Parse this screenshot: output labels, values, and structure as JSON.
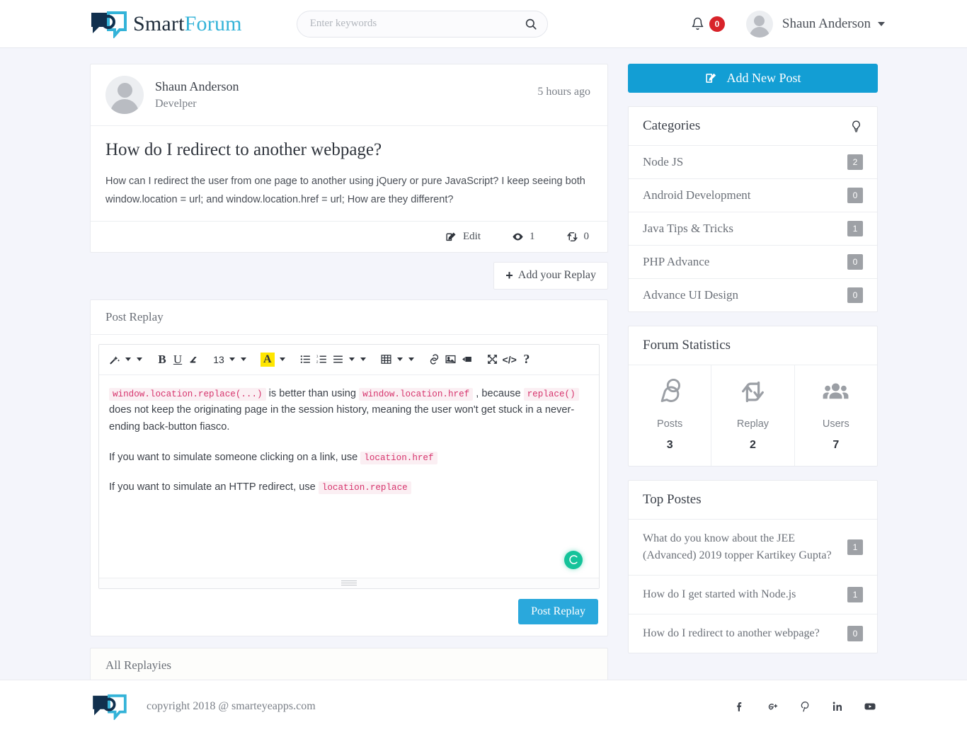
{
  "brand": {
    "name_1": "Smart",
    "name_2": "Forum",
    "logo_icon": "chat-bubbles-logo"
  },
  "search": {
    "placeholder": "Enter keywords",
    "value": "",
    "icon": "search-icon"
  },
  "header": {
    "notification_icon": "bell-icon",
    "notification_count": "0",
    "user_name": "Shaun Anderson",
    "avatar_icon": "user-avatar",
    "caret_icon": "chevron-down-icon"
  },
  "post": {
    "author": "Shaun Anderson",
    "role": "Develper",
    "time": "5 hours ago",
    "title": "How do I redirect to another webpage?",
    "body": "How can I redirect the user from one page to another using jQuery or pure JavaScript? I keep seeing both window.location = url; and window.location.href = url; How are they different?",
    "edit_label": "Edit",
    "edit_icon": "edit-pencil-icon",
    "views_icon": "eye-icon",
    "views_count": "1",
    "replies_icon": "retweet-icon",
    "replies_count": "0"
  },
  "add_reply_button": {
    "label": "Add your Replay",
    "plus": "+"
  },
  "reply_panel": {
    "title": "Post Replay",
    "submit_label": "Post Replay",
    "grammarly_icon": "grammarly-badge-icon"
  },
  "editor": {
    "toolbar": [
      {
        "name": "style-magic-wand-icon",
        "type": "icon"
      },
      {
        "name": "style-dropdown-caret",
        "type": "caret"
      },
      {
        "name": "paragraph-style-caret",
        "type": "caret"
      },
      {
        "name": "bold-button",
        "type": "text",
        "label": "B"
      },
      {
        "name": "underline-button",
        "type": "text",
        "label": "U"
      },
      {
        "name": "clear-formatting-icon",
        "type": "icon"
      },
      {
        "name": "font-size-value",
        "type": "text",
        "label": "13"
      },
      {
        "name": "font-size-caret",
        "type": "caret"
      },
      {
        "name": "font-family-caret",
        "type": "caret"
      },
      {
        "name": "text-color-button",
        "type": "text",
        "label": "A"
      },
      {
        "name": "text-color-caret",
        "type": "caret"
      },
      {
        "name": "unordered-list-icon",
        "type": "icon"
      },
      {
        "name": "ordered-list-icon",
        "type": "icon"
      },
      {
        "name": "align-icon",
        "type": "icon"
      },
      {
        "name": "align-caret",
        "type": "caret"
      },
      {
        "name": "line-height-caret",
        "type": "caret"
      },
      {
        "name": "table-icon",
        "type": "icon"
      },
      {
        "name": "table-caret",
        "type": "caret"
      },
      {
        "name": "more-caret",
        "type": "caret"
      },
      {
        "name": "insert-link-icon",
        "type": "icon"
      },
      {
        "name": "insert-image-icon",
        "type": "icon"
      },
      {
        "name": "insert-video-icon",
        "type": "icon"
      },
      {
        "name": "fullscreen-icon",
        "type": "icon"
      },
      {
        "name": "code-view-icon",
        "type": "text",
        "label": "</>"
      },
      {
        "name": "help-icon",
        "type": "text",
        "label": "?"
      }
    ],
    "font_size": "13",
    "color_letter": "A",
    "code_view_label": "</>",
    "help_label": "?",
    "paragraphs": [
      {
        "parts": [
          {
            "t": "code",
            "v": "window.location.replace(...)"
          },
          {
            "t": "text",
            "v": " is better than using "
          },
          {
            "t": "code",
            "v": "window.location.href"
          },
          {
            "t": "text",
            "v": " , because "
          },
          {
            "t": "code",
            "v": "replace()"
          },
          {
            "t": "text",
            "v": " does not keep the originating page in the session history, meaning the user won't get stuck in a never-ending back-button fiasco."
          }
        ]
      },
      {
        "parts": [
          {
            "t": "text",
            "v": "If you want to simulate someone clicking on a link, use "
          },
          {
            "t": "code",
            "v": "location.href"
          }
        ]
      },
      {
        "parts": [
          {
            "t": "text",
            "v": "If you want to simulate an HTTP redirect, use "
          },
          {
            "t": "code",
            "v": "location.replace"
          }
        ]
      }
    ]
  },
  "all_replies_panel": {
    "title": "All Replayies"
  },
  "sidebar": {
    "add_new_post": {
      "label": "Add New Post",
      "icon": "edit-square-icon"
    },
    "categories": {
      "title": "Categories",
      "icon": "lightbulb-icon",
      "items": [
        {
          "label": "Node JS",
          "count": "2"
        },
        {
          "label": "Android Development",
          "count": "0"
        },
        {
          "label": "Java Tips & Tricks",
          "count": "1"
        },
        {
          "label": "PHP Advance",
          "count": "0"
        },
        {
          "label": "Advance UI Design",
          "count": "0"
        }
      ]
    },
    "forum_statistics": {
      "title": "Forum Statistics",
      "items": [
        {
          "label": "Posts",
          "value": "3",
          "icon": "comments-icon"
        },
        {
          "label": "Replay",
          "value": "2",
          "icon": "retweet-icon"
        },
        {
          "label": "Users",
          "value": "7",
          "icon": "users-icon"
        }
      ]
    },
    "top_postes": {
      "title": "Top Postes",
      "items": [
        {
          "label": "What do you know about the JEE (Advanced) 2019 topper Kartikey Gupta?",
          "count": "1"
        },
        {
          "label": "How do I get started with Node.js",
          "count": "1"
        },
        {
          "label": "How do I redirect to another webpage?",
          "count": "0"
        }
      ]
    }
  },
  "footer": {
    "copyright": "copyright 2018 @ smarteyeapps.com",
    "logo_icon": "chat-bubbles-logo",
    "socials": [
      {
        "name": "facebook-icon"
      },
      {
        "name": "google-plus-icon"
      },
      {
        "name": "pinterest-icon"
      },
      {
        "name": "linkedin-icon"
      },
      {
        "name": "youtube-icon"
      }
    ]
  },
  "colors": {
    "accent_blue": "#139ed4",
    "button_blue": "#2aa8dc",
    "brand_teal": "#34b3d8",
    "badge_red": "#d8232a",
    "badge_gray": "#9ea1a6",
    "code_pink": "#d6336c",
    "grammarly_green": "#15c39a",
    "page_bg": "#f4f5fb"
  }
}
